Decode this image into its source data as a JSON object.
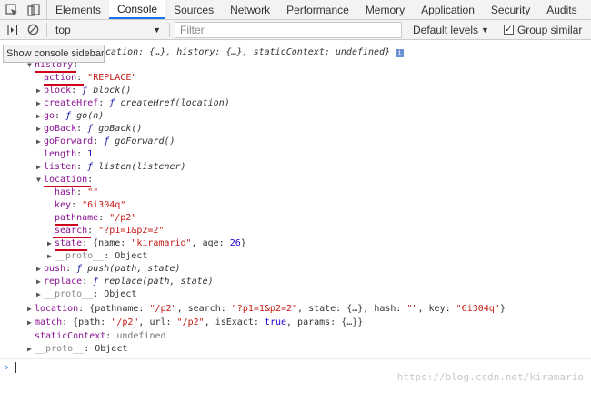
{
  "tabs": [
    "Elements",
    "Console",
    "Sources",
    "Network",
    "Performance",
    "Memory",
    "Application",
    "Security",
    "Audits"
  ],
  "toolbar": {
    "context": "top",
    "filter_placeholder": "Filter",
    "levels": "Default levels",
    "group_similar": "Group similar"
  },
  "tooltip": "Show console sidebar",
  "console": {
    "summary_text": "{location: {…}, history: {…}, staticContext: undefined}",
    "summary_hidden_prefix": "ocation: {…}, history: {…}, staticContext: undefined}",
    "lines": {
      "history_key": "history",
      "action_key": "action",
      "action_val": "\"REPLACE\"",
      "block_key": "block",
      "block_val": "block()",
      "createHref_key": "createHref",
      "createHref_val": "createHref(location)",
      "go_key": "go",
      "go_val": "go(n)",
      "goBack_key": "goBack",
      "goBack_val": "goBack()",
      "goForward_key": "goForward",
      "goForward_val": "goForward()",
      "length_key": "length",
      "length_val": "1",
      "listen_key": "listen",
      "listen_val": "listen(listener)",
      "location_key": "location",
      "hash_key": "hash",
      "hash_val": "\"\"",
      "key_key": "key",
      "key_val": "\"6i304q\"",
      "pathname_key": "pathname",
      "pathname_val": "\"/p2\"",
      "search_key": "search",
      "search_val": "\"?p1=1&p2=2\"",
      "state_key": "state",
      "state_val_open": "{name: ",
      "state_name_val": "\"kiramario\"",
      "state_age_sep": ", age: ",
      "state_age_val": "26",
      "state_val_close": "}",
      "proto1_key": "__proto__",
      "proto1_val": "Object",
      "push_key": "push",
      "push_val": "push(path, state)",
      "replace_key": "replace",
      "replace_val": "replace(path, state)",
      "proto2_key": "__proto__",
      "proto2_val": "Object",
      "loc2_key": "location",
      "loc2_p1": "{pathname: ",
      "loc2_pathname_val": "\"/p2\"",
      "loc2_p2": ", search: ",
      "loc2_search_val": "\"?p1=1&p2=2\"",
      "loc2_p3": ", state: {…}, hash: ",
      "loc2_hash_val": "\"\"",
      "loc2_p4": ", key: ",
      "loc2_key_val": "\"6i304q\"",
      "loc2_p5": "}",
      "match_key": "match",
      "match_p1": "{path: ",
      "match_path_val": "\"/p2\"",
      "match_p2": ", url: ",
      "match_url_val": "\"/p2\"",
      "match_p3": ", isExact: ",
      "match_exact_val": "true",
      "match_p4": ", params: {…}}",
      "static_key": "staticContext",
      "static_val": "undefined",
      "proto3_key": "__proto__",
      "proto3_val": "Object"
    }
  },
  "watermark": "https://blog.csdn.net/kiramario",
  "colors": {
    "accent": "#1a73e8",
    "underline": "#d0021b",
    "key": "#881391",
    "string": "#c41a16"
  }
}
